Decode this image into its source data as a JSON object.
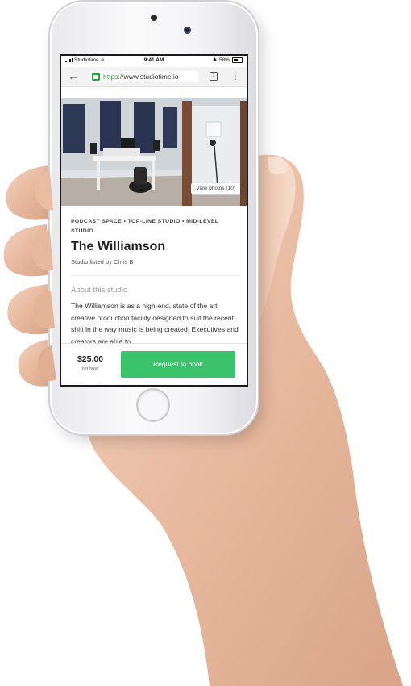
{
  "status_bar": {
    "carrier": "Studiotime",
    "time": "9:41 AM",
    "battery": "58%"
  },
  "browser": {
    "url_scheme": "https://",
    "url_host": "www.studiotime.io",
    "tab_count": "1",
    "icons": [
      "back-arrow-icon",
      "lock-icon",
      "tabs-icon",
      "more-vertical-icon"
    ]
  },
  "hero": {
    "view_photos_label": "View photos (10)"
  },
  "listing": {
    "category": "PODCAST SPACE • TOP-LINE STUDIO • MID-LEVEL STUDIO",
    "title": "The Williamson",
    "lister": "Studio listed by Chris B"
  },
  "about": {
    "heading": "About this studio",
    "body": "The Williamson is as a high-end, state of the art creative production facility designed to suit the recent shift in the way music is being created. Executives and creators are able to"
  },
  "booking": {
    "price": "$25.00",
    "price_unit": "per hour",
    "request_label": "Request to book"
  },
  "colors": {
    "accent": "#3bc36c",
    "secure_green": "#2e9e3a"
  }
}
